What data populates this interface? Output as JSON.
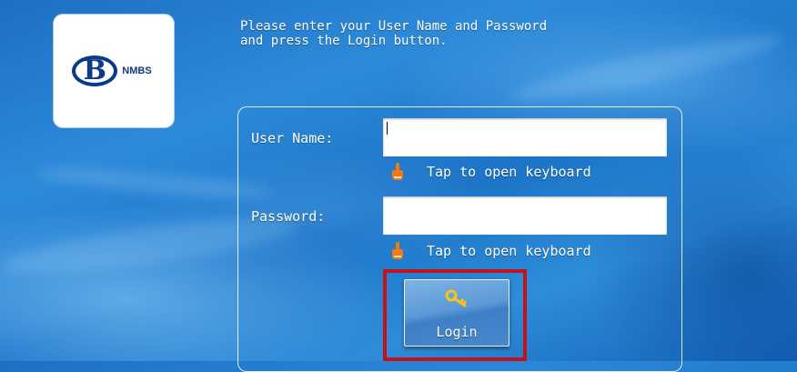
{
  "logo": {
    "mark_letter": "B",
    "brand_text": "NMBS"
  },
  "instructions": {
    "line1": "Please enter your User Name and Password",
    "line2": "and press the Login button."
  },
  "form": {
    "username": {
      "label": "User Name:",
      "value": "",
      "hint": "Tap to open keyboard"
    },
    "password": {
      "label": "Password:",
      "value": "",
      "hint": "Tap to open keyboard"
    },
    "login_button": {
      "label": "Login",
      "icon": "key-icon"
    }
  },
  "colors": {
    "highlight": "#c4121a",
    "logo_blue": "#0a3a8a",
    "hint_icon": "#f07a10"
  }
}
